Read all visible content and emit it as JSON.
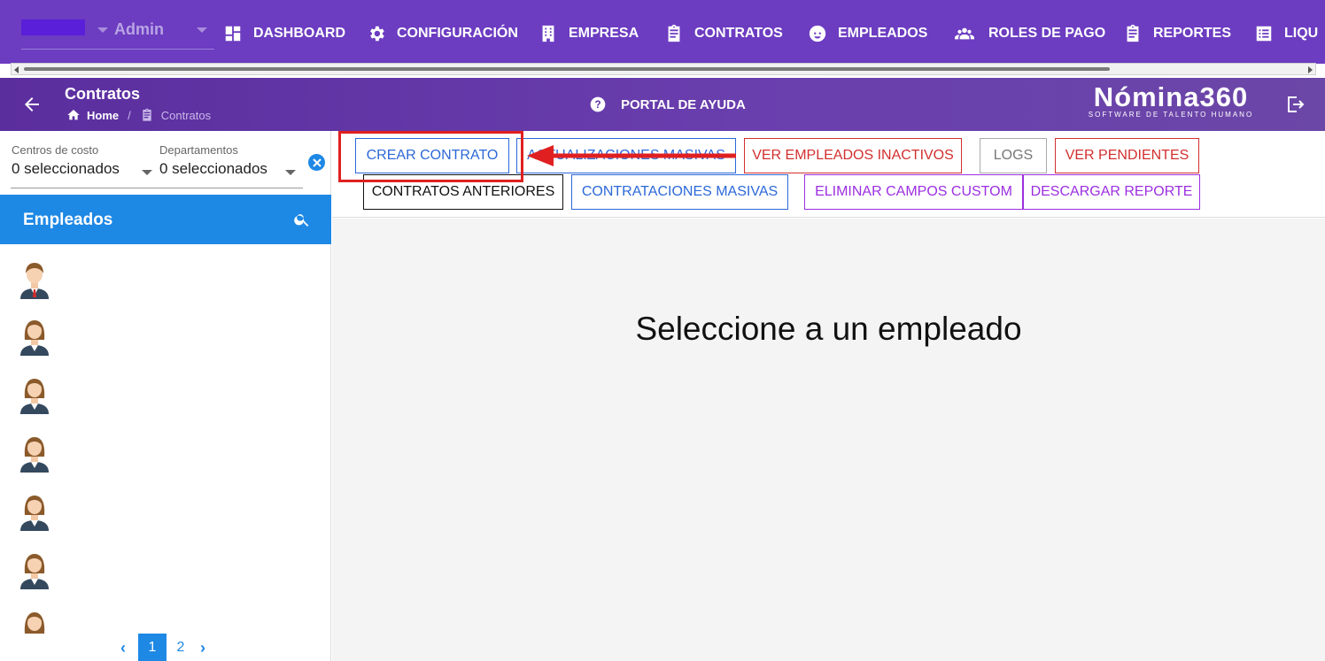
{
  "topnav": {
    "role": "Admin",
    "items": [
      {
        "label": "DASHBOARD",
        "icon": "dashboard-icon"
      },
      {
        "label": "CONFIGURACIÓN",
        "icon": "gear-icon"
      },
      {
        "label": "EMPRESA",
        "icon": "building-icon"
      },
      {
        "label": "CONTRATOS",
        "icon": "clipboard-icon"
      },
      {
        "label": "EMPLEADOS",
        "icon": "face-icon"
      },
      {
        "label": "ROLES DE PAGO",
        "icon": "people-group-icon"
      },
      {
        "label": "REPORTES",
        "icon": "clipboard-icon"
      },
      {
        "label": "LIQU",
        "icon": "list-icon"
      }
    ]
  },
  "header": {
    "title": "Contratos",
    "breadcrumb": {
      "home": "Home",
      "sep": "/",
      "current": "Contratos"
    },
    "help": "PORTAL DE AYUDA",
    "brand": {
      "name": "Nómina360",
      "tagline": "SOFTWARE DE TALENTO HUMANO"
    }
  },
  "sidebar": {
    "filters": [
      {
        "label": "Centros de costo",
        "value": "0 seleccionados"
      },
      {
        "label": "Departamentos",
        "value": "0 seleccionados"
      }
    ],
    "employees_title": "Empleados",
    "pagination": {
      "prev": "‹",
      "pages": [
        "1",
        "2"
      ],
      "next": "›",
      "current": "1"
    }
  },
  "toolbar": {
    "row1": [
      "CREAR CONTRATO",
      "ACTUALIZACIONES MASIVAS",
      "VER EMPLEADOS INACTIVOS",
      "LOGS",
      "VER PENDIENTES"
    ],
    "row2": [
      "CONTRATOS ANTERIORES",
      "CONTRATACIONES MASIVAS",
      "ELIMINAR CAMPOS CUSTOM",
      "DESCARGAR REPORTE"
    ]
  },
  "main": {
    "prompt": "Seleccione a un empleado"
  },
  "colors": {
    "nav": "#6c3cc1",
    "accent": "#1e88e5",
    "annotation": "#e02020"
  }
}
